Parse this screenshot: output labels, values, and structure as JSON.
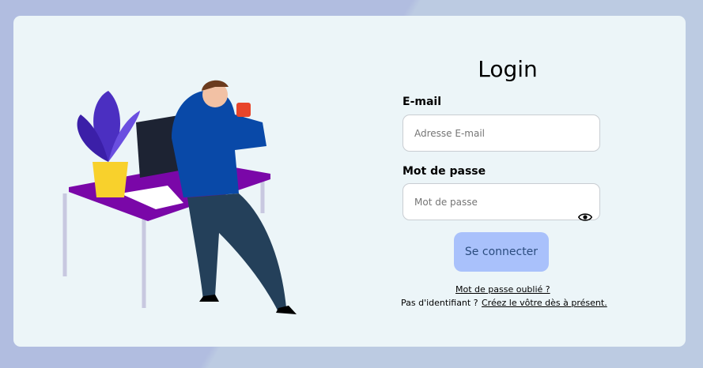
{
  "title": "Login",
  "email": {
    "label": "E-mail",
    "placeholder": "Adresse E-mail",
    "value": ""
  },
  "password": {
    "label": "Mot de passe",
    "placeholder": "Mot de passe",
    "value": "",
    "toggle_icon": "eye-icon"
  },
  "submit_label": "Se connecter",
  "forgot_label": "Mot de passe oublié ?",
  "no_account_text": "Pas d'identifiant ?",
  "signup_label": "Créez le vôtre dès à présent.",
  "colors": {
    "button": "#a9c1fb",
    "card": "#ecf5f8",
    "background": "#b1bde0"
  }
}
